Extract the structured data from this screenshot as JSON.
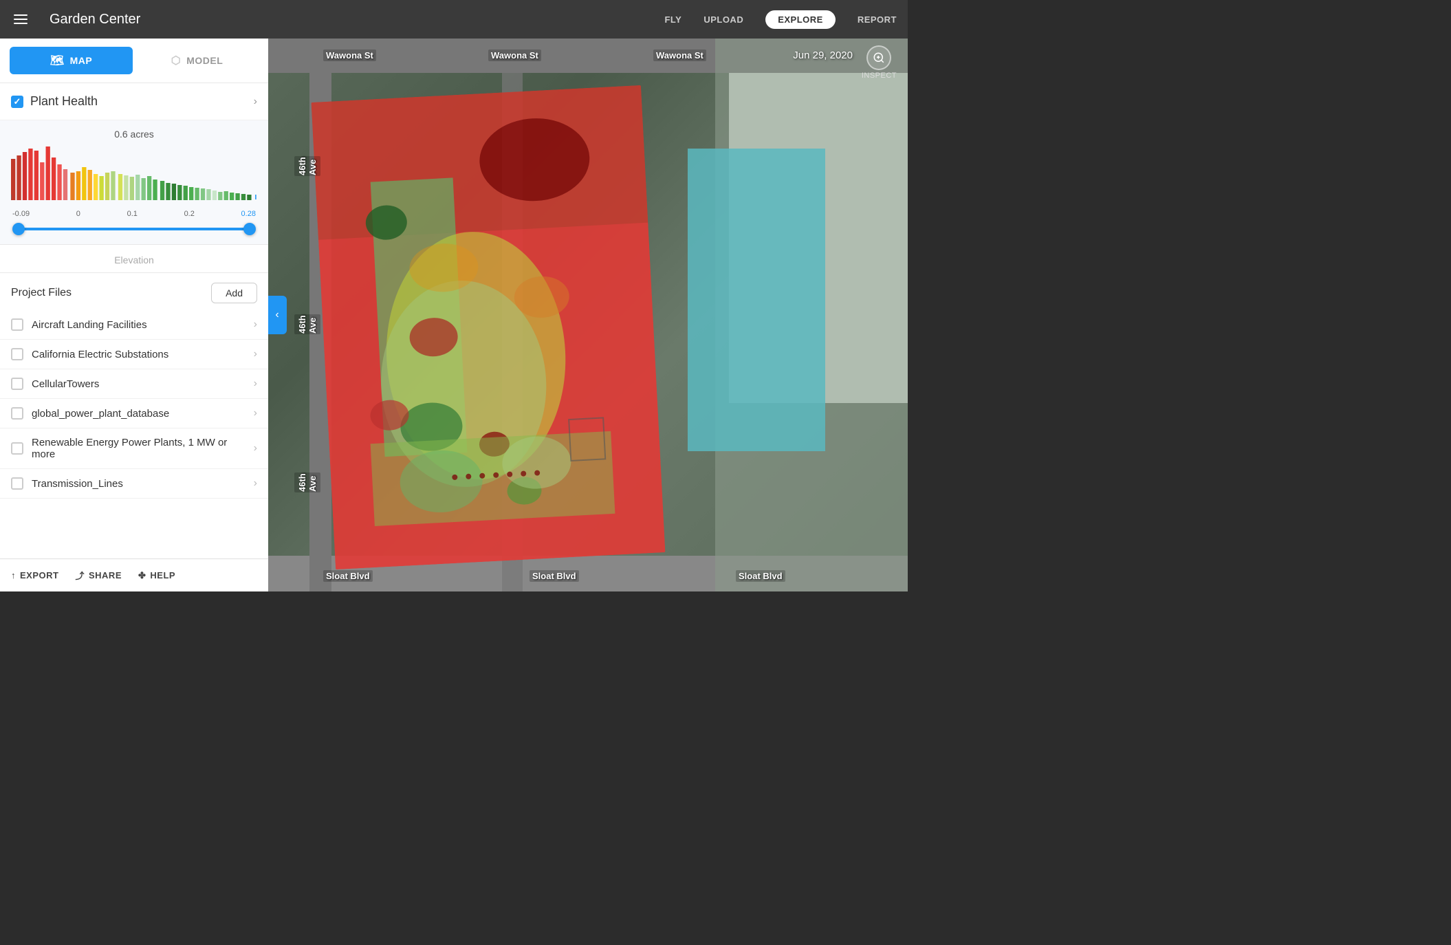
{
  "header": {
    "menu_icon": "hamburger-icon",
    "app_title": "Garden Center",
    "nav": [
      {
        "id": "fly",
        "label": "FLY",
        "active": false
      },
      {
        "id": "upload",
        "label": "UPLOAD",
        "active": false
      },
      {
        "id": "explore",
        "label": "EXPLORE",
        "active": true
      },
      {
        "id": "report",
        "label": "REPORT",
        "active": false
      }
    ]
  },
  "sidebar": {
    "view_toggle": {
      "map_label": "MAP",
      "model_label": "MODEL",
      "active": "map"
    },
    "plant_health": {
      "label": "Plant Health",
      "checked": true,
      "acres": "0.6 acres"
    },
    "histogram": {
      "range_min": "-0.09",
      "range_zero": "0",
      "range_01": "0.1",
      "range_02": "0.2",
      "range_max": "0.28"
    },
    "elevation": {
      "label": "Elevation"
    },
    "project_files": {
      "title": "Project Files",
      "add_label": "Add",
      "items": [
        {
          "id": 1,
          "name": "Aircraft Landing Facilities",
          "checked": false
        },
        {
          "id": 2,
          "name": "California Electric Substations",
          "checked": false
        },
        {
          "id": 3,
          "name": "CellularTowers",
          "checked": false
        },
        {
          "id": 4,
          "name": "global_power_plant_database",
          "checked": false
        },
        {
          "id": 5,
          "name": "Renewable Energy Power Plants, 1 MW or more",
          "checked": false
        },
        {
          "id": 6,
          "name": "Transmission_Lines",
          "checked": false
        }
      ]
    },
    "footer": {
      "export_label": "EXPORT",
      "share_label": "SHARE",
      "help_label": "HELP"
    }
  },
  "map": {
    "date": "Jun 29, 2020",
    "inspect_label": "INSPECT",
    "street_labels": [
      "Wawona St",
      "Wawona St",
      "Wawona St",
      "46th Ave",
      "46th Ave",
      "46th Ave",
      "Sloat Blvd",
      "Sloat Blvd",
      "Sloat Blvd"
    ],
    "collapse_arrow": "‹"
  },
  "icons": {
    "map_icon": "◫",
    "model_icon": "◈",
    "check": "✓",
    "chevron_right": "›",
    "export_icon": "↑",
    "share_icon": "⤴",
    "help_icon": "✿",
    "inspect_icon": "⊕"
  }
}
